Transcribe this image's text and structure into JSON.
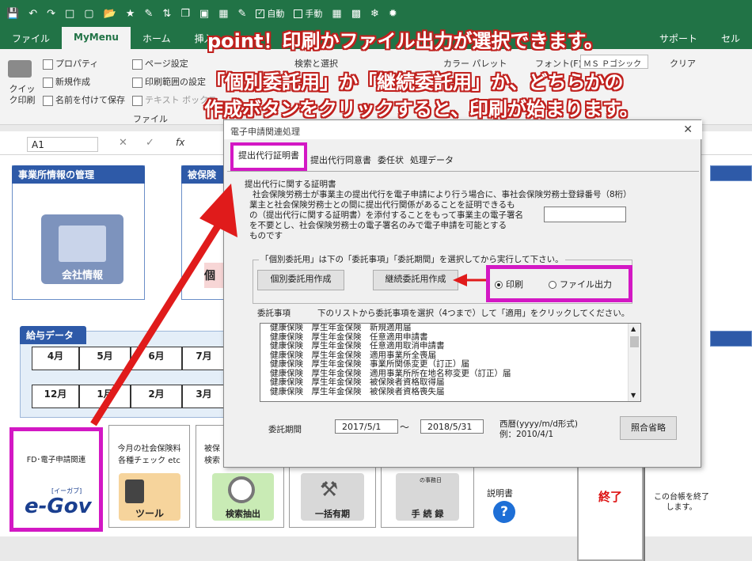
{
  "qat": {
    "auto_label": "自動",
    "manual_label": "手動"
  },
  "tabs": [
    "ファイル",
    "MyMenu",
    "ホーム",
    "挿入"
  ],
  "tabs_right": [
    "サポート",
    "セル"
  ],
  "ribbon": {
    "quick_print": "クイック印刷",
    "properties": "プロパティ",
    "new": "新規作成",
    "save_as": "名前を付けて保存",
    "page_setup": "ページ設定",
    "print_area": "印刷範囲の設定",
    "textbox": "テキスト ボックス",
    "group_file": "ファイル",
    "search_select": "検索と選択",
    "color_palette": "カラー パレット",
    "font_label": "フォント(F)",
    "font_value": "ＭＳ Ｐゴシック",
    "clear": "クリア"
  },
  "namebox": "A1",
  "sheet": {
    "company_panel_title": "事業所情報の管理",
    "company_button": "会社情報",
    "insured_panel_title": "被保険",
    "insured_button_partial": "個",
    "salary_panel_title": "給与データ",
    "months_row1": [
      "4月",
      "5月",
      "6月",
      "7月"
    ],
    "months_row2": [
      "12月",
      "1月",
      "2月",
      "3月"
    ]
  },
  "bottom": {
    "egov_title": "FD･電子申請関連",
    "egov_logo": "e-Gov",
    "egov_kana": "[イーガブ]",
    "social_title_1": "今月の社会保険料",
    "social_title_2": "各種チェック etc",
    "tool_label": "ツール",
    "insured_title_1": "被保",
    "insured_title_2": "検索・",
    "search_extract": "検索抽出",
    "bulk": "一括有期",
    "notebook_top": "の事務日",
    "notebook": "手 続 録",
    "manual": "説明書",
    "exit": "終了",
    "exit_note": "この台帳を終了します。"
  },
  "dialog": {
    "title": "電子申請関連処理",
    "tabs": [
      "提出代行証明書",
      "提出代行同意書",
      "委任状",
      "処理データ"
    ],
    "cert_heading": "提出代行に関する証明書",
    "cert_text": [
      "社会保険労務士が事業主の提出代行を電子申請により行う場合に、事社会保険労務士登録番号（8桁）",
      "業主と社会保険労務士との間に提出代行関係があることを証明できるも",
      "の（提出代行に関する証明書）を添付することをもって事業主の電子署名",
      "を不要とし、社会保険労務士の電子署名のみで電子申請を可能とする",
      "ものです"
    ],
    "reg_number": "",
    "group_label": "「個別委託用」は下の「委託事項」「委託期間」を選択してから実行して下さい。",
    "btn_individual": "個別委託用作成",
    "btn_continuous": "継続委託用作成",
    "radio_print": "印刷",
    "radio_file": "ファイル出力",
    "entrust_label": "委託事項",
    "entrust_instruction": "下のリストから委託事項を選択（4つまで）して「適用」をクリックしてください。",
    "list_items": [
      "健康保険　厚生年金保険　新規適用届",
      "健康保険　厚生年金保険　任意適用申請書",
      "健康保険　厚生年金保険　任意適用取消申請書",
      "健康保険　厚生年金保険　適用事業所全喪届",
      "健康保険　厚生年金保険　事業所関係変更（訂正）届",
      "健康保険　厚生年金保険　適用事業所所在地名称変更（訂正）届",
      "健康保険　厚生年金保険　被保険者資格取得届",
      "健康保険　厚生年金保険　被保険者資格喪失届"
    ],
    "period_label": "委託期間",
    "date_from": "2017/5/1",
    "tilde": "～",
    "date_to": "2018/5/31",
    "format_note": "西暦(yyyy/m/d形式)",
    "example_note": "例：2010/4/1",
    "btn_omit": "照合省略"
  },
  "annotations": {
    "line1": "point！印刷かファイル出力が選択できます。",
    "line2": "「個別委託用」か「継続委託用」か、どちらかの",
    "line3": "作成ボタンをクリックすると、印刷が始まります。"
  },
  "colors": {
    "excel_green": "#217346",
    "highlight": "#d318c4",
    "arrow": "#e01b1b",
    "panel_blue": "#2e5aa8"
  }
}
